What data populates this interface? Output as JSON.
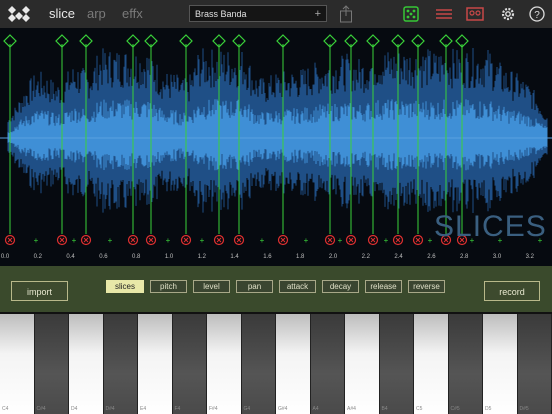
{
  "header": {
    "tabs": [
      {
        "label": "slice",
        "active": true
      },
      {
        "label": "arp",
        "active": false
      },
      {
        "label": "effx",
        "active": false
      }
    ],
    "preset_name": "Brass Banda",
    "preset_add": "+",
    "icons": [
      "logo-diamonds-icon",
      "share-icon",
      "dice-icon",
      "list-icon",
      "tape-icon",
      "gear-icon",
      "help-icon"
    ]
  },
  "waveform": {
    "overlay_label": "SLICES",
    "time_ticks": [
      "0.0",
      "0.2",
      "0.4",
      "0.6",
      "0.8",
      "1.0",
      "1.2",
      "1.4",
      "1.6",
      "1.8",
      "2.0",
      "2.2",
      "2.4",
      "2.6",
      "2.8",
      "3.0",
      "3.2"
    ],
    "colors": {
      "wave": "#3f8fd6",
      "slice_line": "#3ad13a",
      "marker": "#e03030"
    }
  },
  "controls": {
    "import_label": "import",
    "record_label": "record",
    "params": [
      {
        "label": "slices",
        "selected": true
      },
      {
        "label": "pitch",
        "selected": false
      },
      {
        "label": "level",
        "selected": false
      },
      {
        "label": "pan",
        "selected": false
      },
      {
        "label": "attack",
        "selected": false
      },
      {
        "label": "decay",
        "selected": false
      },
      {
        "label": "release",
        "selected": false
      },
      {
        "label": "reverse",
        "selected": false
      }
    ]
  },
  "keyboard": {
    "labels": [
      "C4",
      "C#4",
      "D4",
      "D#4",
      "E4",
      "F4",
      "F#4",
      "G4",
      "G#4",
      "A4",
      "A#4",
      "B4",
      "C5",
      "C#5",
      "D5",
      "D#5"
    ]
  }
}
